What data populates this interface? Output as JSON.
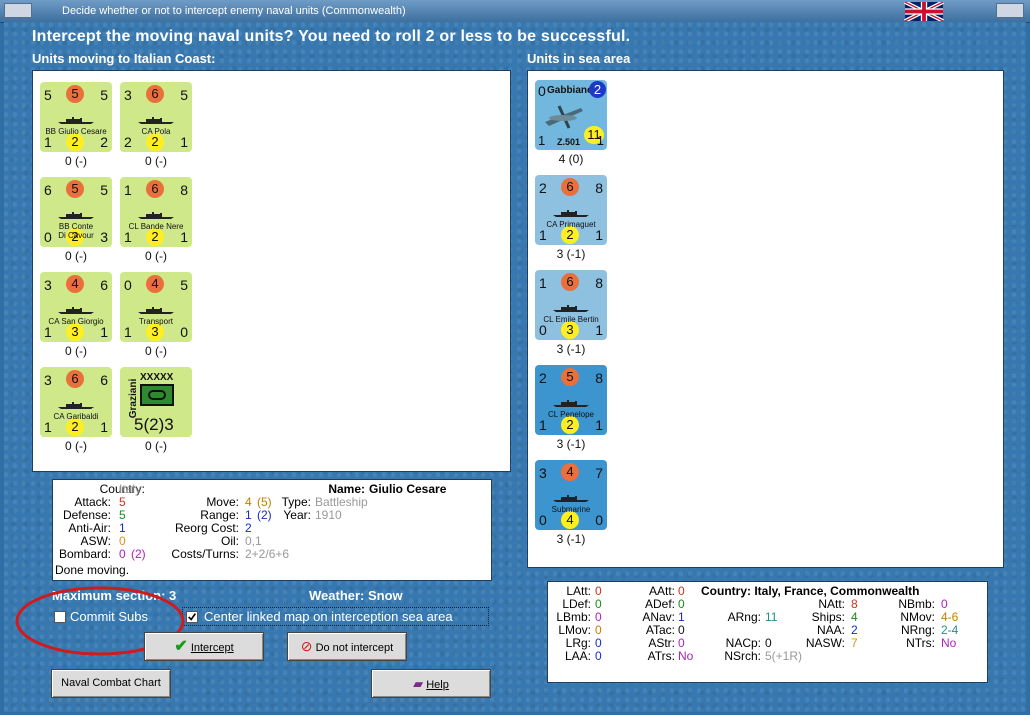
{
  "window": {
    "title": "Decide whether or not to intercept enemy naval units (Commonwealth)"
  },
  "heading": "Intercept the moving naval units?  You need to roll 2 or less to be successful.",
  "left_header": "Units moving to Italian Coast:",
  "right_header": "Units in sea area",
  "moving_units": [
    {
      "tl": "5",
      "circle": "5",
      "tr": "5",
      "name": "BB Giulio Cesare",
      "bl": "1",
      "yc": "2",
      "br": "2",
      "sub": "0 (-)"
    },
    {
      "tl": "3",
      "circle": "6",
      "tr": "5",
      "name": "CA Pola",
      "bl": "2",
      "yc": "2",
      "br": "1",
      "sub": "0 (-)"
    },
    {
      "tl": "6",
      "circle": "5",
      "tr": "5",
      "name": "BB Conte\nDi Cavour",
      "bl": "0",
      "yc": "2",
      "br": "3",
      "sub": "0 (-)"
    },
    {
      "tl": "1",
      "circle": "6",
      "tr": "8",
      "name": "CL Bande Nere",
      "bl": "1",
      "yc": "2",
      "br": "1",
      "sub": "0 (-)"
    },
    {
      "tl": "3",
      "circle": "4",
      "tr": "6",
      "name": "CA San Giorgio",
      "bl": "1",
      "yc": "3",
      "br": "1",
      "sub": "0 (-)"
    },
    {
      "tl": "0",
      "circle": "4",
      "tr": "5",
      "name": "Transport",
      "bl": "1",
      "yc": "3",
      "br": "0",
      "sub": "0 (-)"
    },
    {
      "tl": "3",
      "circle": "6",
      "tr": "6",
      "name": "CA Garibaldi",
      "bl": "1",
      "yc": "2",
      "br": "1",
      "sub": "0 (-)"
    }
  ],
  "army_unit": {
    "side": "Graziani",
    "size": "XXXXX",
    "strength": "5(2)3",
    "sub": "0 (-)"
  },
  "sea_units": [
    {
      "tl": "0",
      "name": "Gabbiano",
      "badge": "2",
      "code": "Z.501",
      "value": "11",
      "bl": "1",
      "br": "1",
      "sub": "4 (0)"
    },
    {
      "tl": "2",
      "circle": "6",
      "tr": "8",
      "name": "CA Primaguet",
      "bl": "1",
      "yc": "2",
      "br": "1",
      "sub": "3 (-1)"
    },
    {
      "tl": "1",
      "circle": "6",
      "tr": "8",
      "name": "CL Emile Bertin",
      "bl": "0",
      "yc": "3",
      "br": "1",
      "sub": "3 (-1)"
    },
    {
      "tl": "2",
      "circle": "5",
      "tr": "8",
      "name": "CL Penelope",
      "bl": "1",
      "yc": "2",
      "br": "1",
      "sub": "3 (-1)"
    },
    {
      "tl": "3",
      "circle": "4",
      "tr": "7",
      "name": "Submarine",
      "bl": "0",
      "yc": "4",
      "br": "0",
      "sub": "3 (-1)"
    }
  ],
  "info": {
    "country_lbl": "Country:",
    "country": "Italy",
    "attack_lbl": "Attack:",
    "attack": "5",
    "defense_lbl": "Defense:",
    "defense": "5",
    "aa_lbl": "Anti-Air:",
    "aa": "1",
    "asw_lbl": "ASW:",
    "asw": "0",
    "bombard_lbl": "Bombard:",
    "bombard": "0",
    "bombard_paren": "(2)",
    "move_lbl": "Move:",
    "move": "4",
    "move_paren": "(5)",
    "range_lbl": "Range:",
    "range": "1",
    "range_paren": "(2)",
    "reorg_lbl": "Reorg Cost:",
    "reorg": "2",
    "oil_lbl": "Oil:",
    "oil": "0,1",
    "costs_lbl": "Costs/Turns:",
    "costs": "2+2/6+6",
    "name_lbl": "Name:",
    "name": "Giulio Cesare",
    "type_lbl": "Type:",
    "type": "Battleship",
    "year_lbl": "Year:",
    "year": "1910",
    "status": "Done moving."
  },
  "max_section": "Maximum section: 3",
  "weather": "Weather:  Snow",
  "commit_subs": "Commit Subs",
  "center_map": "Center linked map on interception sea area",
  "buttons": {
    "intercept": "Intercept",
    "no_intercept": "Do not intercept",
    "chart": "Naval Combat Chart",
    "help": "Help"
  },
  "stats": {
    "latt": "LAtt:",
    "latt_v": "0",
    "ldef": "LDef:",
    "ldef_v": "0",
    "lbmb": "LBmb:",
    "lbmb_v": "0",
    "lmov": "LMov:",
    "lmov_v": "0",
    "lrg": "LRg:",
    "lrg_v": "0",
    "laa": "LAA:",
    "laa_v": "0",
    "aatt": "AAtt:",
    "aatt_v": "0",
    "adef": "ADef:",
    "adef_v": "0",
    "anav": "ANav:",
    "anav_v": "1",
    "atac": "ATac:",
    "atac_v": "0",
    "astr": "AStr:",
    "astr_v": "0",
    "atrs": "ATrs:",
    "atrs_v": "No",
    "country": "Country: Italy, France, Commonwealth",
    "arng": "ARng:",
    "arng_v": "11",
    "nacp": "NACp:",
    "nacp_v": "0",
    "nsrch": "NSrch:",
    "nsrch_v": "5(+1R)",
    "natt": "NAtt:",
    "natt_v": "8",
    "ships": "Ships:",
    "ships_v": "4",
    "naa": "NAA:",
    "naa_v": "2",
    "nasw": "NASW:",
    "nasw_v": "7",
    "nbmb": "NBmb:",
    "nbmb_v": "0",
    "nmov": "NMov:",
    "nmov_v": "4-6",
    "nrng": "NRng:",
    "nrng_v": "2-4",
    "ntrs": "NTrs:",
    "ntrs_v": "No"
  },
  "colors": {
    "accent": "#3778b0",
    "annotation_red": "#d11a1a"
  }
}
